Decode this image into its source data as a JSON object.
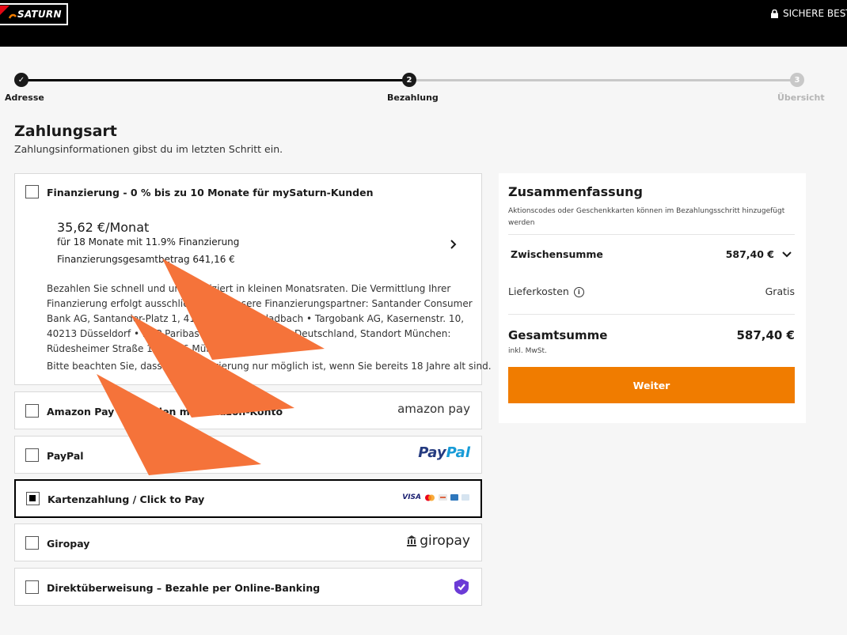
{
  "header": {
    "logo_text": "SATURN",
    "secure_text": "SICHERE BEST"
  },
  "stepper": {
    "steps": [
      {
        "label": "Adresse",
        "number": "✓",
        "state": "done"
      },
      {
        "label": "Bezahlung",
        "number": "2",
        "state": "active"
      },
      {
        "label": "Übersicht",
        "number": "3",
        "state": "pending"
      }
    ]
  },
  "page": {
    "title": "Zahlungsart",
    "subtitle": "Zahlungsinformationen gibst du im letzten Schritt ein."
  },
  "payments": [
    {
      "label": "Finanzierung - 0 % bis zu 10 Monate für mySaturn-Kunden",
      "checked": false
    },
    {
      "label": "Amazon Pay - Bezahlen mit Amazon-Konto",
      "checked": false,
      "brand": "amazon pay"
    },
    {
      "label": "PayPal",
      "checked": false,
      "brand_a": "Pay",
      "brand_b": "Pal"
    },
    {
      "label": "Kartenzahlung / Click to Pay",
      "checked": true,
      "brand": "VISA"
    },
    {
      "label": "Giropay",
      "checked": false,
      "brand": "giropay"
    },
    {
      "label": "Direktüberweisung – Bezahle per Online-Banking",
      "checked": false
    }
  ],
  "financing": {
    "amount": "35,62 €/Monat",
    "term": "für 18 Monate mit 11.9% Finanzierung",
    "total": "Finanzierungsgesamtbetrag 641,16 €",
    "description": "Bezahlen Sie schnell und unkompliziert in kleinen Monatsraten. Die Vermittlung Ihrer Finanzierung erfolgt ausschließlich an unsere Finanzierungspartner: Santander Consumer Bank AG, Santander-Platz 1, 41061 Mönchengladbach • Targobank AG, Kasernenstr. 10, 40213 Düsseldorf • BNP Paribas S.A. Niederlassung Deutschland, Standort München: Rüdesheimer Straße 1, 80686 München.",
    "note": "Bitte beachten Sie, dass eine Finanzierung nur möglich ist, wenn Sie bereits 18 Jahre alt sind."
  },
  "summary": {
    "title": "Zusammenfassung",
    "hint": "Aktionscodes oder Geschenkkarten können im Bezahlungsschritt hinzugefügt werden",
    "subtotal_label": "Zwischensumme",
    "subtotal_value": "587,40 €",
    "shipping_label": "Lieferkosten",
    "shipping_value": "Gratis",
    "total_label": "Gesamtsumme",
    "total_value": "587,40 €",
    "vat_note": "inkl. MwSt.",
    "button": "Weiter"
  },
  "colors": {
    "accent": "#f07c00",
    "arrow": "#f5733a",
    "paypal_dark": "#253b80",
    "paypal_light": "#179bd7"
  }
}
